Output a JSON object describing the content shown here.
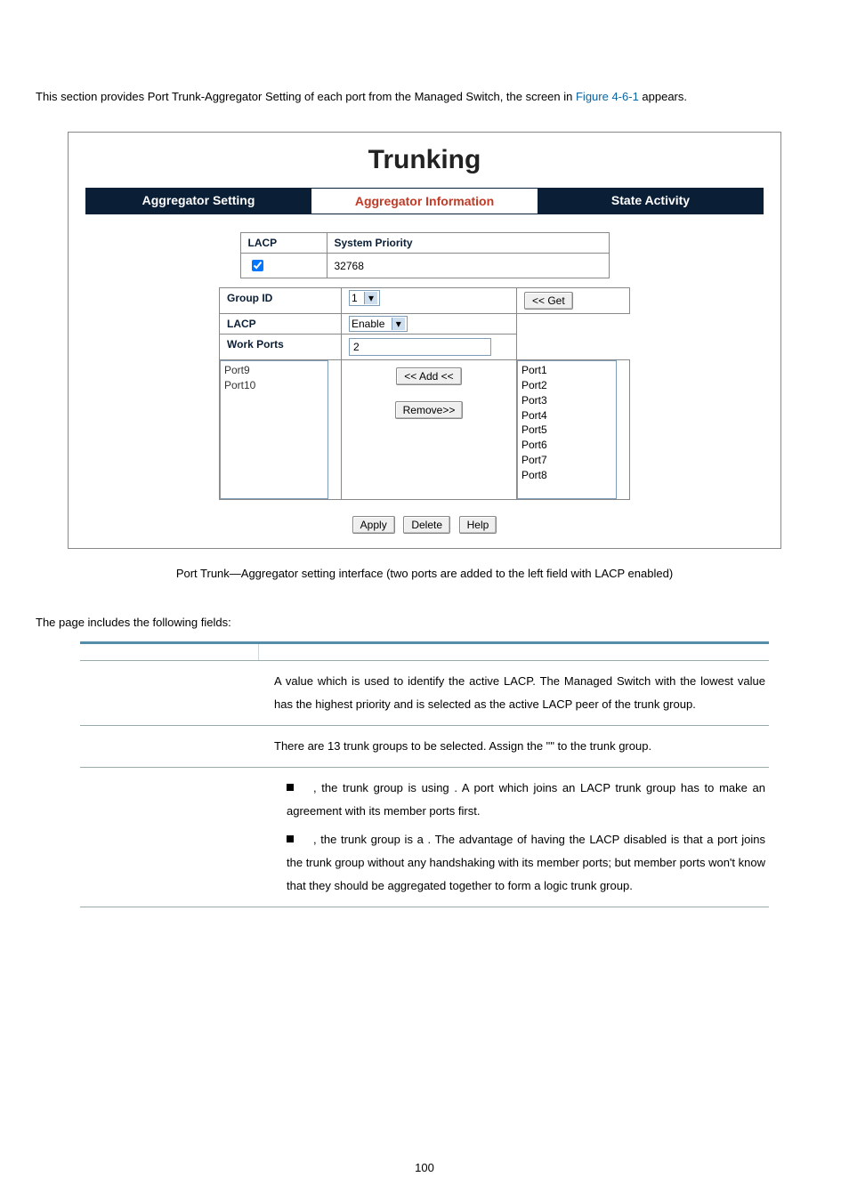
{
  "intro": {
    "pre": "This section provides Port Trunk-Aggregator Setting of each port from the Managed Switch, the screen in ",
    "figref": "Figure 4-6-1",
    "post": " appears."
  },
  "ui": {
    "title": "Trunking",
    "tabs": {
      "left": "Aggregator Setting",
      "mid": "Aggregator Information",
      "right": "State Activity"
    },
    "lacp_header": "LACP",
    "sys_priority_header": "System Priority",
    "sys_priority_value": "32768",
    "group_id_header": "Group ID",
    "group_id_value": "1",
    "get_btn": "<< Get",
    "lacp_row_header": "LACP",
    "lacp_row_value": "Enable",
    "work_ports_header": "Work Ports",
    "work_ports_value": "2",
    "left_ports": [
      "Port9",
      "Port10"
    ],
    "right_ports": [
      "Port1",
      "Port2",
      "Port3",
      "Port4",
      "Port5",
      "Port6",
      "Port7",
      "Port8"
    ],
    "add_btn": "<< Add <<",
    "remove_btn": "Remove>>",
    "apply_btn": "Apply",
    "delete_btn": "Delete",
    "help_btn": "Help"
  },
  "caption": "Port Trunk—Aggregator setting interface (two ports are added to the left field with LACP enabled)",
  "subhead": "The page includes the following fields:",
  "desc": {
    "rows": [
      {
        "text": "A value which is used to identify the active LACP. The Managed Switch with the lowest value has the highest priority and is selected as the active LACP peer of the trunk group."
      },
      {
        "pre": "There are 13 trunk groups to be selected. Assign the \"",
        "mid": "",
        "post": "\" to the trunk group."
      },
      {
        "b1_pre": ", the trunk group is using ",
        "b1_mid": "",
        "b1_post": ". A port which joins an LACP trunk group has to make an agreement with its member ports first.",
        "b2_pre": ", the trunk group is a ",
        "b2_mid": "",
        "b2_post": ". The advantage of having the LACP disabled is that a port joins the trunk group without any handshaking with its member ports; but member ports won't know that they should be aggregated together to form a logic trunk group."
      }
    ]
  },
  "page_number": "100"
}
